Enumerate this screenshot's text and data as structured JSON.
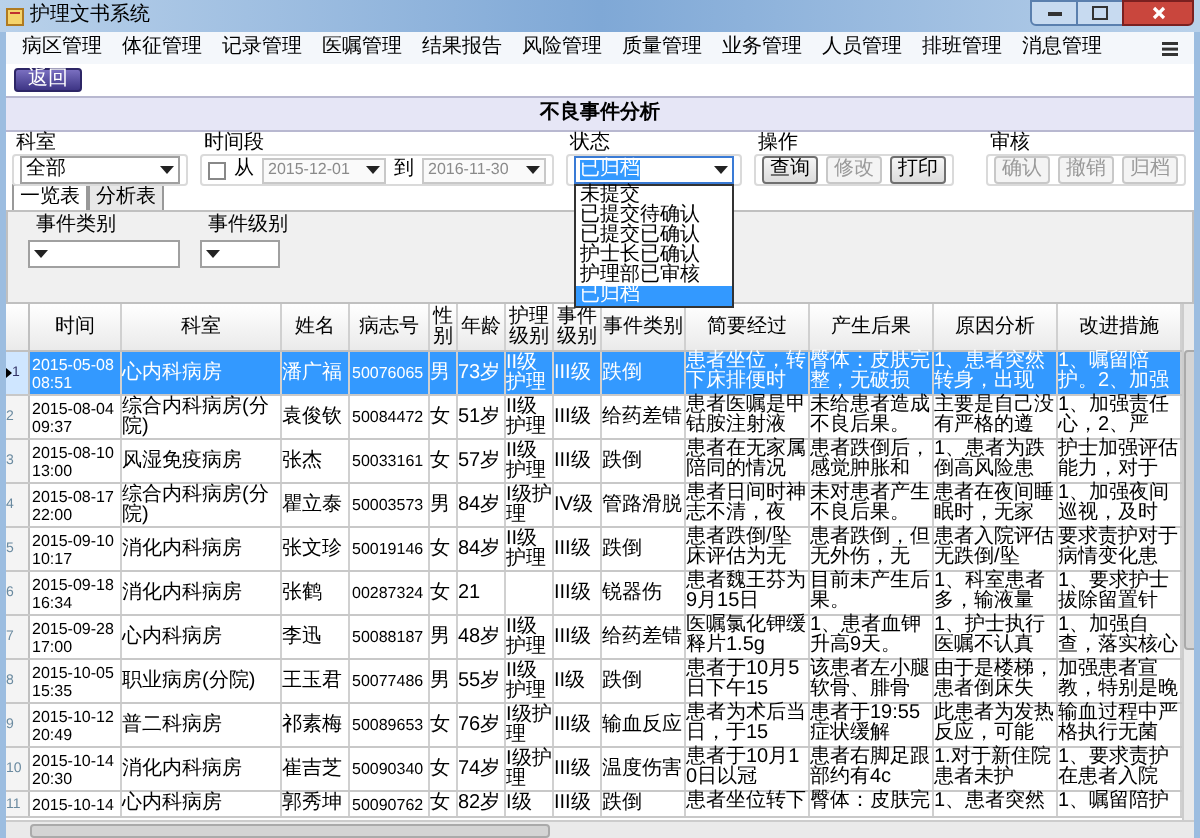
{
  "window": {
    "title": "护理文书系统"
  },
  "menu": [
    "病区管理",
    "体征管理",
    "记录管理",
    "医嘱管理",
    "结果报告",
    "风险管理",
    "质量管理",
    "业务管理",
    "人员管理",
    "排班管理",
    "消息管理"
  ],
  "back_button": "返回",
  "page_title": "不良事件分析",
  "filters": {
    "department": {
      "label": "科室",
      "value": "全部"
    },
    "period": {
      "label": "时间段",
      "checked": false,
      "from_label": "从",
      "from": "2015-12-01",
      "to_label": "到",
      "to": "2016-11-30",
      "disabled": true
    },
    "status": {
      "label": "状态",
      "value": "已归档",
      "options": [
        {
          "label": "未提交",
          "selected": false
        },
        {
          "label": "已提交待确认",
          "selected": false
        },
        {
          "label": "已提交已确认",
          "selected": false
        },
        {
          "label": "护士长已确认",
          "selected": false
        },
        {
          "label": "护理部已审核",
          "selected": false
        },
        {
          "label": "已归档",
          "selected": true
        }
      ]
    },
    "actions": {
      "label": "操作",
      "buttons": [
        {
          "label": "查询",
          "disabled": false
        },
        {
          "label": "修改",
          "disabled": true
        },
        {
          "label": "打印",
          "disabled": false
        }
      ]
    },
    "review": {
      "label": "审核",
      "buttons": [
        {
          "label": "确认",
          "disabled": true
        },
        {
          "label": "撤销",
          "disabled": true
        },
        {
          "label": "归档",
          "disabled": true
        }
      ]
    }
  },
  "tabs": [
    {
      "label": "一览表",
      "selected": true
    },
    {
      "label": "分析表",
      "selected": false
    }
  ],
  "sub_filters": [
    {
      "label": "事件类别"
    },
    {
      "label": "事件级别"
    }
  ],
  "table": {
    "columns": [
      "时间",
      "科室",
      "姓名",
      "病志号",
      "性别",
      "年龄",
      "护理级别",
      "事件级别",
      "事件类别",
      "简要经过",
      "产生后果",
      "原因分析",
      "改进措施"
    ],
    "rows": [
      {
        "number": "1",
        "selected": true,
        "cells": [
          "2015-05-08 08:51",
          "心内科病房",
          "潘广福",
          "50076065",
          "男",
          "73岁",
          "II级护理",
          "III级",
          "跌倒",
          "患者坐位，转下床排便时",
          "臀体：皮肤完整，无破损",
          "1、患者突然转身，出现",
          "1、嘱留陪护。2、加强"
        ]
      },
      {
        "number": "2",
        "selected": false,
        "cells": [
          "2015-08-04 09:37",
          "综合内科病房(分院)",
          "袁俊钦",
          "50084472",
          "女",
          "51岁",
          "II级护理",
          "III级",
          "给药差错",
          "患者医嘱是甲钴胺注射液",
          "未给患者造成不良后果。",
          "主要是自己没有严格的遵",
          "1、加强责任心，2、严"
        ]
      },
      {
        "number": "3",
        "selected": false,
        "cells": [
          "2015-08-10 13:00",
          "风湿免疫病房",
          "张杰",
          "50033161",
          "女",
          "57岁",
          "II级护理",
          "III级",
          "跌倒",
          "患者在无家属陪同的情况",
          "患者跌倒后，感觉肿胀和",
          "1、患者为跌倒高风险患",
          "护士加强评估能力，对于"
        ]
      },
      {
        "number": "4",
        "selected": false,
        "cells": [
          "2015-08-17 22:00",
          "综合内科病房(分院)",
          "瞿立泰",
          "50003573",
          "男",
          "84岁",
          "I级护理",
          "IV级",
          "管路滑脱",
          "患者日间时神志不清，夜",
          "未对患者产生不良后果。",
          "患者在夜间睡眠时，无家",
          "1、加强夜间巡视，及时"
        ]
      },
      {
        "number": "5",
        "selected": false,
        "cells": [
          "2015-09-10 10:17",
          "消化内科病房",
          "张文珍",
          "50019146",
          "女",
          "84岁",
          "II级护理",
          "III级",
          "跌倒",
          "患者跌倒/坠床评估为无",
          "患者跌倒，但无外伤，无",
          "患者入院评估无跌倒/坠",
          "要求责护对于病情变化患"
        ]
      },
      {
        "number": "6",
        "selected": false,
        "cells": [
          "2015-09-18 16:34",
          "消化内科病房",
          "张鹤",
          "00287324",
          "女",
          "21",
          "",
          "III级",
          "锐器伤",
          "患者魏王芬为9月15日",
          "目前未产生后果。",
          "1、科室患者多，输液量",
          "1、要求护士拔除留置针"
        ]
      },
      {
        "number": "7",
        "selected": false,
        "cells": [
          "2015-09-28 17:00",
          "心内科病房",
          "李迅",
          "50088187",
          "男",
          "48岁",
          "II级护理",
          "III级",
          "给药差错",
          "医嘱氯化钾缓释片1.5g",
          "1、患者血钾升高9天。",
          "1、护士执行医嘱不认真",
          "1、加强自查，落实核心"
        ]
      },
      {
        "number": "8",
        "selected": false,
        "cells": [
          "2015-10-05 15:35",
          "职业病房(分院)",
          "王玉君",
          "50077486",
          "男",
          "55岁",
          "II级护理",
          "II级",
          "跌倒",
          "患者于10月5日下午15",
          "该患者左小腿软骨、腓骨",
          "由于是楼梯，患者倒床失",
          "加强患者宣教，特别是晚"
        ]
      },
      {
        "number": "9",
        "selected": false,
        "cells": [
          "2015-10-12 20:49",
          "普二科病房",
          "祁素梅",
          "50089653",
          "女",
          "76岁",
          "I级护理",
          "III级",
          "输血反应",
          "患者为术后当日，于15",
          "患者于19:55症状缓解",
          "此患者为发热反应，可能",
          "输血过程中严格执行无菌"
        ]
      },
      {
        "number": "10",
        "selected": false,
        "cells": [
          "2015-10-14 20:30",
          "消化内科病房",
          "崔吉芝",
          "50090340",
          "女",
          "74岁",
          "I级护理",
          "III级",
          "温度伤害",
          "患者于10月10日以冠",
          "患者右脚足跟部约有4c",
          "1.对于新住院患者未护",
          "1、要求责护在患者入院"
        ]
      },
      {
        "number": "11",
        "selected": false,
        "cells": [
          "2015-10-14",
          "心内科病房",
          "郭秀坤",
          "50090762",
          "女",
          "82岁",
          "I级",
          "III级",
          "跌倒",
          "患者坐位转下",
          "臀体：皮肤完",
          "1、患者突然",
          "1、嘱留陪护"
        ]
      }
    ]
  }
}
